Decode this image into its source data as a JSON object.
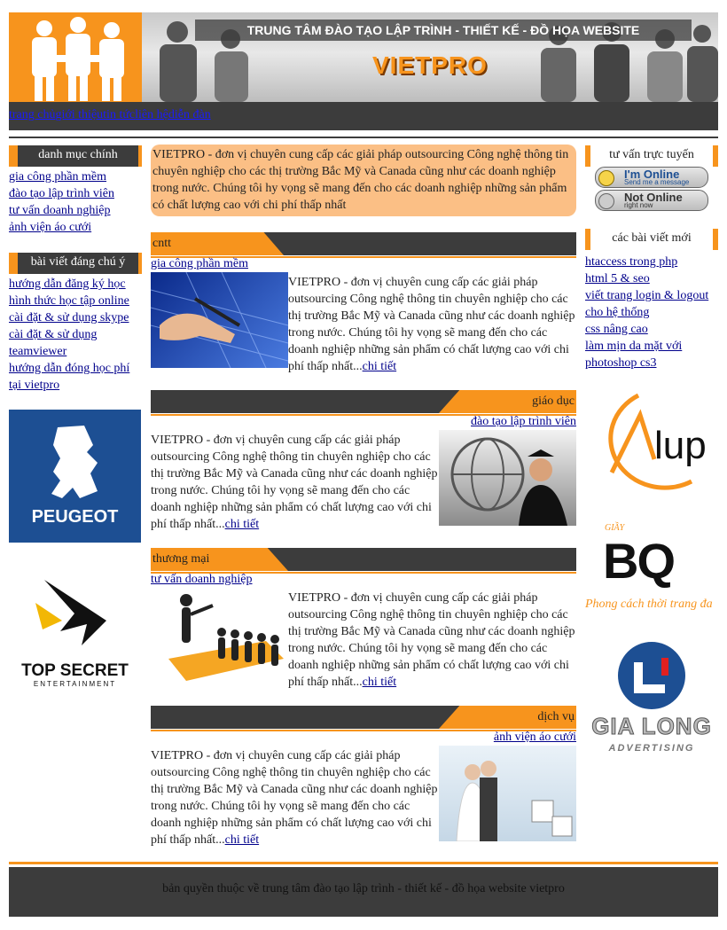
{
  "header": {
    "title": "TRUNG TÂM ĐÀO TẠO LẬP TRÌNH - THIẾT KẾ - ĐỒ HỌA WEBSITE",
    "brand": "VIETPRO"
  },
  "nav": {
    "links": [
      "trang chủ",
      "giới thiệu",
      "tin tức",
      "liên hệ",
      "diễn đàn"
    ]
  },
  "left_sidebar": {
    "categories_title": "danh mục chính",
    "categories": [
      "gia công phần mềm",
      "đào tạo lập trình viên",
      "tư vấn doanh nghiệp",
      "ảnh viện áo cưới"
    ],
    "featured_title": "bài viết đáng chú ý",
    "featured": [
      "hướng dẫn đăng ký học",
      "hình thức học tập online",
      "cài đặt & sử dụng skype",
      "cài đặt & sử dụng teamviewer",
      "hướng dẫn đóng học phí tại vietpro"
    ],
    "ads": [
      {
        "name": "PEUGEOT"
      },
      {
        "name": "TOP SECRET",
        "sub": "ENTERTAINMENT"
      }
    ]
  },
  "intro": "VIETPRO - đơn vị chuyên cung cấp các giải pháp outsourcing Công nghệ thông tin chuyên nghiệp cho các thị trường Bắc Mỹ và Canada cũng như các doanh nghiệp trong nước. Chúng tôi hy vọng sẽ mang đến cho các doanh nghiệp những sản phẩm có chất lượng cao với chi phí thấp nhất",
  "sections": [
    {
      "category": "cntt",
      "article_link": "gia công phần mềm",
      "text": "VIETPRO - đơn vị chuyên cung cấp các giải pháp outsourcing Công nghệ thông tin chuyên nghiệp cho các thị trường Bắc Mỹ và Canada cũng như các doanh nghiệp trong nước. Chúng tôi hy vọng sẽ mang đến cho các doanh nghiệp những sản phẩm có chất lượng cao với chi phí thấp nhất...",
      "more": "chi tiết"
    },
    {
      "category": "giáo dục",
      "article_link": "đào tạo lập trình viên",
      "text": "VIETPRO - đơn vị chuyên cung cấp các giải pháp outsourcing Công nghệ thông tin chuyên nghiệp cho các thị trường Bắc Mỹ và Canada cũng như các doanh nghiệp trong nước. Chúng tôi hy vọng sẽ mang đến cho các doanh nghiệp những sản phẩm có chất lượng cao với chi phí thấp nhất...",
      "more": "chi tiết"
    },
    {
      "category": "thương mại",
      "article_link": "tư vấn doanh nghiệp",
      "text": "VIETPRO - đơn vị chuyên cung cấp các giải pháp outsourcing Công nghệ thông tin chuyên nghiệp cho các thị trường Bắc Mỹ và Canada cũng như các doanh nghiệp trong nước. Chúng tôi hy vọng sẽ mang đến cho các doanh nghiệp những sản phẩm có chất lượng cao với chi phí thấp nhất...",
      "more": "chi tiết"
    },
    {
      "category": "dịch vụ",
      "article_link": "ảnh viện áo cưới",
      "text": "VIETPRO - đơn vị chuyên cung cấp các giải pháp outsourcing Công nghệ thông tin chuyên nghiệp cho các thị trường Bắc Mỹ và Canada cũng như các doanh nghiệp trong nước. Chúng tôi hy vọng sẽ mang đến cho các doanh nghiệp những sản phẩm có chất lượng cao với chi phí thấp nhất...",
      "more": "chi tiết"
    }
  ],
  "right_sidebar": {
    "support_title": "tư vấn trực tuyến",
    "online_status": {
      "big": "I'm Online",
      "small": "Send me a message"
    },
    "offline_status": {
      "big": "Not Online",
      "small": "right now"
    },
    "recent_title": "các bài viết mới",
    "recent": [
      "htaccess trong php",
      "html 5 & seo",
      "viết trang login & logout cho hệ thống",
      "css nâng cao",
      "làm mịn da mặt với photoshop cs3"
    ],
    "ads": [
      {
        "name": "lup"
      },
      {
        "top": "GIẦY",
        "name": "BQ",
        "slogan": "Phong cách thời trang đa"
      },
      {
        "name": "GIA LONG",
        "sub": "ADVERTISING"
      }
    ]
  },
  "footer": "bản quyền thuộc về trung tâm đào tạo lập trình - thiết kế - đồ họa website vietpro",
  "colors": {
    "orange": "#f7941d",
    "dark": "#3c3c3c",
    "intro_bg": "#fbbf85",
    "link": "#00008b"
  }
}
